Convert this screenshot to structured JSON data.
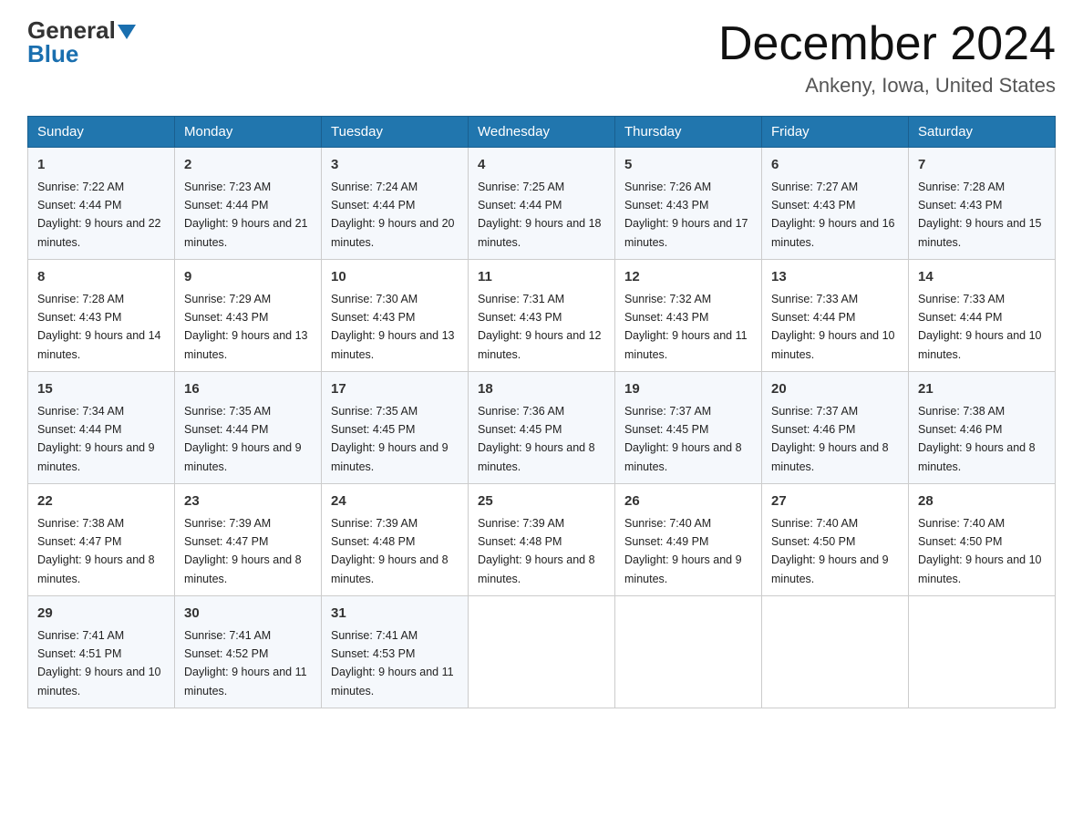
{
  "header": {
    "logo_line1": "General",
    "logo_line2": "Blue",
    "month_title": "December 2024",
    "location": "Ankeny, Iowa, United States"
  },
  "weekdays": [
    "Sunday",
    "Monday",
    "Tuesday",
    "Wednesday",
    "Thursday",
    "Friday",
    "Saturday"
  ],
  "weeks": [
    [
      {
        "day": "1",
        "sunrise": "7:22 AM",
        "sunset": "4:44 PM",
        "daylight": "9 hours and 22 minutes."
      },
      {
        "day": "2",
        "sunrise": "7:23 AM",
        "sunset": "4:44 PM",
        "daylight": "9 hours and 21 minutes."
      },
      {
        "day": "3",
        "sunrise": "7:24 AM",
        "sunset": "4:44 PM",
        "daylight": "9 hours and 20 minutes."
      },
      {
        "day": "4",
        "sunrise": "7:25 AM",
        "sunset": "4:44 PM",
        "daylight": "9 hours and 18 minutes."
      },
      {
        "day": "5",
        "sunrise": "7:26 AM",
        "sunset": "4:43 PM",
        "daylight": "9 hours and 17 minutes."
      },
      {
        "day": "6",
        "sunrise": "7:27 AM",
        "sunset": "4:43 PM",
        "daylight": "9 hours and 16 minutes."
      },
      {
        "day": "7",
        "sunrise": "7:28 AM",
        "sunset": "4:43 PM",
        "daylight": "9 hours and 15 minutes."
      }
    ],
    [
      {
        "day": "8",
        "sunrise": "7:28 AM",
        "sunset": "4:43 PM",
        "daylight": "9 hours and 14 minutes."
      },
      {
        "day": "9",
        "sunrise": "7:29 AM",
        "sunset": "4:43 PM",
        "daylight": "9 hours and 13 minutes."
      },
      {
        "day": "10",
        "sunrise": "7:30 AM",
        "sunset": "4:43 PM",
        "daylight": "9 hours and 13 minutes."
      },
      {
        "day": "11",
        "sunrise": "7:31 AM",
        "sunset": "4:43 PM",
        "daylight": "9 hours and 12 minutes."
      },
      {
        "day": "12",
        "sunrise": "7:32 AM",
        "sunset": "4:43 PM",
        "daylight": "9 hours and 11 minutes."
      },
      {
        "day": "13",
        "sunrise": "7:33 AM",
        "sunset": "4:44 PM",
        "daylight": "9 hours and 10 minutes."
      },
      {
        "day": "14",
        "sunrise": "7:33 AM",
        "sunset": "4:44 PM",
        "daylight": "9 hours and 10 minutes."
      }
    ],
    [
      {
        "day": "15",
        "sunrise": "7:34 AM",
        "sunset": "4:44 PM",
        "daylight": "9 hours and 9 minutes."
      },
      {
        "day": "16",
        "sunrise": "7:35 AM",
        "sunset": "4:44 PM",
        "daylight": "9 hours and 9 minutes."
      },
      {
        "day": "17",
        "sunrise": "7:35 AM",
        "sunset": "4:45 PM",
        "daylight": "9 hours and 9 minutes."
      },
      {
        "day": "18",
        "sunrise": "7:36 AM",
        "sunset": "4:45 PM",
        "daylight": "9 hours and 8 minutes."
      },
      {
        "day": "19",
        "sunrise": "7:37 AM",
        "sunset": "4:45 PM",
        "daylight": "9 hours and 8 minutes."
      },
      {
        "day": "20",
        "sunrise": "7:37 AM",
        "sunset": "4:46 PM",
        "daylight": "9 hours and 8 minutes."
      },
      {
        "day": "21",
        "sunrise": "7:38 AM",
        "sunset": "4:46 PM",
        "daylight": "9 hours and 8 minutes."
      }
    ],
    [
      {
        "day": "22",
        "sunrise": "7:38 AM",
        "sunset": "4:47 PM",
        "daylight": "9 hours and 8 minutes."
      },
      {
        "day": "23",
        "sunrise": "7:39 AM",
        "sunset": "4:47 PM",
        "daylight": "9 hours and 8 minutes."
      },
      {
        "day": "24",
        "sunrise": "7:39 AM",
        "sunset": "4:48 PM",
        "daylight": "9 hours and 8 minutes."
      },
      {
        "day": "25",
        "sunrise": "7:39 AM",
        "sunset": "4:48 PM",
        "daylight": "9 hours and 8 minutes."
      },
      {
        "day": "26",
        "sunrise": "7:40 AM",
        "sunset": "4:49 PM",
        "daylight": "9 hours and 9 minutes."
      },
      {
        "day": "27",
        "sunrise": "7:40 AM",
        "sunset": "4:50 PM",
        "daylight": "9 hours and 9 minutes."
      },
      {
        "day": "28",
        "sunrise": "7:40 AM",
        "sunset": "4:50 PM",
        "daylight": "9 hours and 10 minutes."
      }
    ],
    [
      {
        "day": "29",
        "sunrise": "7:41 AM",
        "sunset": "4:51 PM",
        "daylight": "9 hours and 10 minutes."
      },
      {
        "day": "30",
        "sunrise": "7:41 AM",
        "sunset": "4:52 PM",
        "daylight": "9 hours and 11 minutes."
      },
      {
        "day": "31",
        "sunrise": "7:41 AM",
        "sunset": "4:53 PM",
        "daylight": "9 hours and 11 minutes."
      },
      null,
      null,
      null,
      null
    ]
  ]
}
